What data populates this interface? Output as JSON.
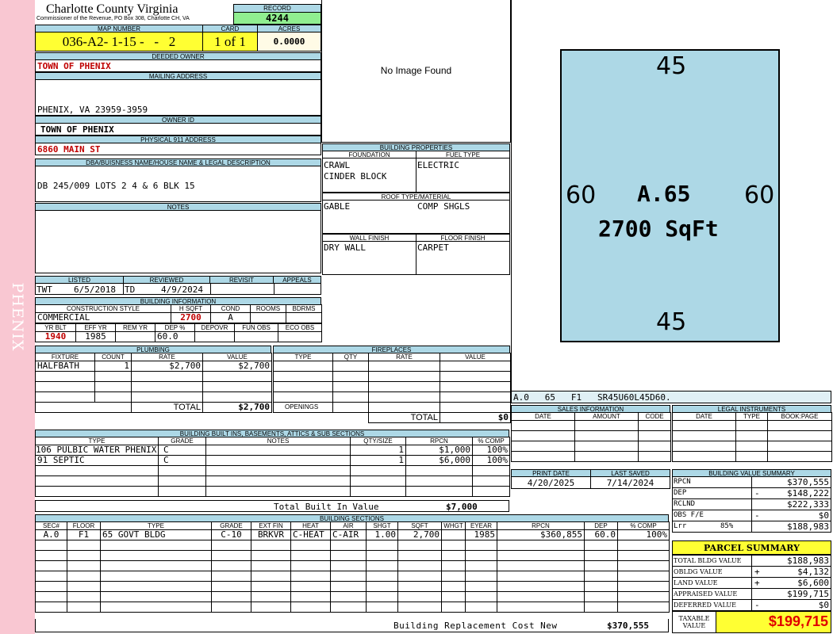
{
  "side_label": "PHENIX",
  "header": {
    "county": "Charlotte County Virginia",
    "commissioner": "Commissioner of the Revenue, PO Box 308, Charlotte CH, VA",
    "record_label": "RECORD",
    "record_value": "4244",
    "map_number_label": "MAP NUMBER",
    "map_number": "036-A2- 1-15 -   -   2",
    "card_label": "CARD",
    "card_value": "1 of 1",
    "acres_label": "ACRES",
    "acres_value": "0.0000"
  },
  "owner": {
    "deeded_owner_label": "DEEDED OWNER",
    "deeded_owner": "TOWN OF PHENIX",
    "mailing_address_label": "MAILING ADDRESS",
    "mailing_address": "PHENIX, VA 23959-3959",
    "owner_id_label": "OWNER ID",
    "owner_id": "TOWN OF PHENIX",
    "physical_address_label": "PHYSICAL 911 ADDRESS",
    "physical_address": "6860 MAIN ST",
    "dba_label": "DBA/BUISNESS NAME/HOUSE NAME & LEGAL DESCRIPTION",
    "dba": "DB 245/009 LOTS 2 4 & 6 BLK 15",
    "notes_label": "NOTES"
  },
  "photo": {
    "no_image": "No Image Found"
  },
  "building_properties": {
    "title": "BUILDING PROPERTIES",
    "foundation_label": "FOUNDATION",
    "fuel_type_label": "FUEL TYPE",
    "foundation_1": "CRAWL",
    "foundation_2": "CINDER BLOCK",
    "fuel_type": "ELECTRIC",
    "roof_label": "ROOF TYPE/MATERIAL",
    "roof_type": "GABLE",
    "roof_material": "COMP SHGLS",
    "wall_finish_label": "WALL FINISH",
    "floor_finish_label": "FLOOR FINISH",
    "wall_finish": "DRY WALL",
    "floor_finish": "CARPET"
  },
  "sketch": {
    "top": "45",
    "bottom": "45",
    "left": "60",
    "right": "60",
    "label": "A.65",
    "area": "2700 SqFt",
    "code": "A.0   65   F1   SR45U60L45D60."
  },
  "listing": {
    "listed_label": "LISTED",
    "reviewed_label": "REVIEWED",
    "revisit_label": "REVISIT",
    "appeals_label": "APPEALS",
    "listed_by": "TWT",
    "listed_date": "6/5/2018",
    "reviewed_by": "TD",
    "reviewed_date": "4/9/2024"
  },
  "building_info": {
    "title": "BUILDING INFORMATION",
    "construction_style_label": "CONSTRUCTION STYLE",
    "hsqft_label": "H SQFT",
    "cond_label": "COND",
    "rooms_label": "ROOMS",
    "bdrms_label": "BDRMS",
    "construction_style": "COMMERCIAL",
    "hsqft": "2700",
    "cond": "A",
    "yr_blt_label": "YR BLT",
    "eff_yr_label": "EFF YR",
    "rem_yr_label": "REM YR",
    "dep_label": "DEP %",
    "depovr_label": "DEPOVR",
    "fun_obs_label": "FUN OBS",
    "eco_obs_label": "ECO OBS",
    "yr_blt": "1940",
    "eff_yr": "1985",
    "dep": "60.0"
  },
  "plumbing": {
    "title": "PLUMBING",
    "headers": [
      "FIXTURE",
      "COUNT",
      "RATE",
      "VALUE"
    ],
    "rows": [
      [
        "HALFBATH",
        "1",
        "$2,700",
        "$2,700"
      ]
    ],
    "total_label": "TOTAL",
    "total": "$2,700"
  },
  "fireplaces": {
    "title": "FIREPLACES",
    "headers": [
      "TYPE",
      "QTY",
      "RATE",
      "VALUE"
    ],
    "openings_label": "OPENINGS",
    "total_label": "TOTAL",
    "total": "$0"
  },
  "sales": {
    "title": "SALES INFORMATION",
    "headers": [
      "DATE",
      "AMOUNT",
      "CODE"
    ]
  },
  "legal": {
    "title": "LEGAL INSTRUMENTS",
    "headers": [
      "DATE",
      "TYPE",
      "BOOK:PAGE"
    ]
  },
  "built_ins": {
    "title": "BUILDING BUILT INS, BASEMENTS, ATTICS & SUB SECTIONS",
    "headers": [
      "TYPE",
      "GRADE",
      "NOTES",
      "QTY/SIZE",
      "RPCN",
      "% COMP"
    ],
    "rows": [
      [
        "106 PULBIC WATER PHENIX",
        "C",
        "",
        "1",
        "$1,000",
        "100%"
      ],
      [
        "91 SEPTIC",
        "C",
        "",
        "1",
        "$6,000",
        "100%"
      ]
    ],
    "total_label": "Total Built In Value",
    "total": "$7,000"
  },
  "dates": {
    "print_date_label": "PRINT DATE",
    "last_saved_label": "LAST SAVED",
    "print_date": "4/20/2025",
    "last_saved": "7/14/2024"
  },
  "value_summary": {
    "title": "BUILDING VALUE SUMMARY",
    "rows": [
      {
        "label": "RPCN",
        "mid": "",
        "sign": "",
        "value": "$370,555"
      },
      {
        "label": "DEP",
        "mid": "",
        "sign": "-",
        "value": "$148,222"
      },
      {
        "label": "RCLND",
        "mid": "",
        "sign": "",
        "value": "$222,333"
      },
      {
        "label": "OBS F/E",
        "mid": "",
        "sign": "-",
        "value": "$0"
      },
      {
        "label": "Lrr",
        "mid": "85%",
        "sign": "",
        "value": "$188,983"
      }
    ]
  },
  "sections": {
    "title": "BUILDING SECTIONS",
    "headers": [
      "SEC#",
      "FLOOR",
      "TYPE",
      "GRADE",
      "EXT FIN",
      "HEAT",
      "AIR",
      "SHGT",
      "SQFT",
      "WHGT",
      "EYEAR",
      "RPCN",
      "DEP",
      "% COMP"
    ],
    "rows": [
      [
        "A.0",
        "F1",
        "65 GOVT BLDG",
        "C-10",
        "BRKVR",
        "C-HEAT",
        "C-AIR",
        "1.00",
        "2,700",
        "",
        "1985",
        "$360,855",
        "60.0",
        "100%"
      ]
    ],
    "replacement_label": "Building Replacement Cost New",
    "replacement": "$370,555"
  },
  "parcel": {
    "title": "PARCEL SUMMARY",
    "rows": [
      {
        "label": "TOTAL BLDG VALUE",
        "sign": "",
        "value": "$188,983"
      },
      {
        "label": "OBLDG VALUE",
        "sign": "+",
        "value": "$4,132"
      },
      {
        "label": "LAND VALUE",
        "sign": "+",
        "value": "$6,600"
      },
      {
        "label": "APPRAISED VALUE",
        "sign": "",
        "value": "$199,715"
      },
      {
        "label": "DEFERRED VALUE",
        "sign": "-",
        "value": "$0"
      }
    ],
    "taxable_label_1": "TAXABLE",
    "taxable_label_2": "VALUE",
    "taxable": "$199,715"
  }
}
